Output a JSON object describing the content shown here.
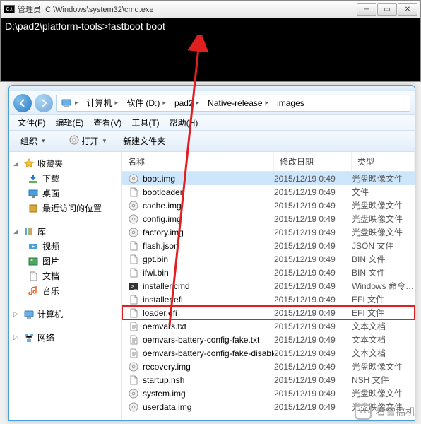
{
  "cmd": {
    "title": "管理员: C:\\Windows\\system32\\cmd.exe",
    "prompt": "D:\\pad2\\platform-tools>fastboot boot"
  },
  "explorer": {
    "breadcrumb": [
      "计算机",
      "软件 (D:)",
      "pad2",
      "Native-release",
      "images"
    ],
    "menu": {
      "file": "文件(F)",
      "edit": "编辑(E)",
      "view": "查看(V)",
      "tools": "工具(T)",
      "help": "帮助(H)"
    },
    "toolbar": {
      "organize": "组织",
      "open": "打开",
      "newfolder": "新建文件夹"
    },
    "columns": {
      "name": "名称",
      "date": "修改日期",
      "type": "类型"
    },
    "sidebar": {
      "favorites": {
        "label": "收藏夹",
        "items": [
          {
            "label": "下载",
            "icon": "download"
          },
          {
            "label": "桌面",
            "icon": "desktop"
          },
          {
            "label": "最近访问的位置",
            "icon": "recent"
          }
        ]
      },
      "libraries": {
        "label": "库",
        "items": [
          {
            "label": "视频",
            "icon": "video"
          },
          {
            "label": "图片",
            "icon": "picture"
          },
          {
            "label": "文档",
            "icon": "document"
          },
          {
            "label": "音乐",
            "icon": "music"
          }
        ]
      },
      "computer": {
        "label": "计算机"
      },
      "network": {
        "label": "网络"
      }
    },
    "files": [
      {
        "name": "boot.img",
        "date": "2015/12/19 0:49",
        "type": "光盘映像文件",
        "icon": "disc",
        "selected": true
      },
      {
        "name": "bootloader",
        "date": "2015/12/19 0:49",
        "type": "文件",
        "icon": "file"
      },
      {
        "name": "cache.img",
        "date": "2015/12/19 0:49",
        "type": "光盘映像文件",
        "icon": "disc"
      },
      {
        "name": "config.img",
        "date": "2015/12/19 0:49",
        "type": "光盘映像文件",
        "icon": "disc"
      },
      {
        "name": "factory.img",
        "date": "2015/12/19 0:49",
        "type": "光盘映像文件",
        "icon": "disc"
      },
      {
        "name": "flash.json",
        "date": "2015/12/19 0:49",
        "type": "JSON 文件",
        "icon": "file"
      },
      {
        "name": "gpt.bin",
        "date": "2015/12/19 0:49",
        "type": "BIN 文件",
        "icon": "file"
      },
      {
        "name": "ifwi.bin",
        "date": "2015/12/19 0:49",
        "type": "BIN 文件",
        "icon": "file"
      },
      {
        "name": "installer.cmd",
        "date": "2015/12/19 0:49",
        "type": "Windows 命令脚本",
        "icon": "cmd"
      },
      {
        "name": "installer.efi",
        "date": "2015/12/19 0:49",
        "type": "EFI 文件",
        "icon": "file"
      },
      {
        "name": "loader.efi",
        "date": "2015/12/19 0:49",
        "type": "EFI 文件",
        "icon": "file",
        "highlighted": true
      },
      {
        "name": "oemvars.txt",
        "date": "2015/12/19 0:49",
        "type": "文本文档",
        "icon": "txt"
      },
      {
        "name": "oemvars-battery-config-fake.txt",
        "date": "2015/12/19 0:49",
        "type": "文本文档",
        "icon": "txt"
      },
      {
        "name": "oemvars-battery-config-fake-disable...",
        "date": "2015/12/19 0:49",
        "type": "文本文档",
        "icon": "txt"
      },
      {
        "name": "recovery.img",
        "date": "2015/12/19 0:49",
        "type": "光盘映像文件",
        "icon": "disc"
      },
      {
        "name": "startup.nsh",
        "date": "2015/12/19 0:49",
        "type": "NSH 文件",
        "icon": "file"
      },
      {
        "name": "system.img",
        "date": "2015/12/19 0:49",
        "type": "光盘映像文件",
        "icon": "disc"
      },
      {
        "name": "userdata.img",
        "date": "2015/12/19 0:49",
        "type": "光盘映像文件",
        "icon": "disc"
      }
    ]
  },
  "watermark": "看雪搞机"
}
